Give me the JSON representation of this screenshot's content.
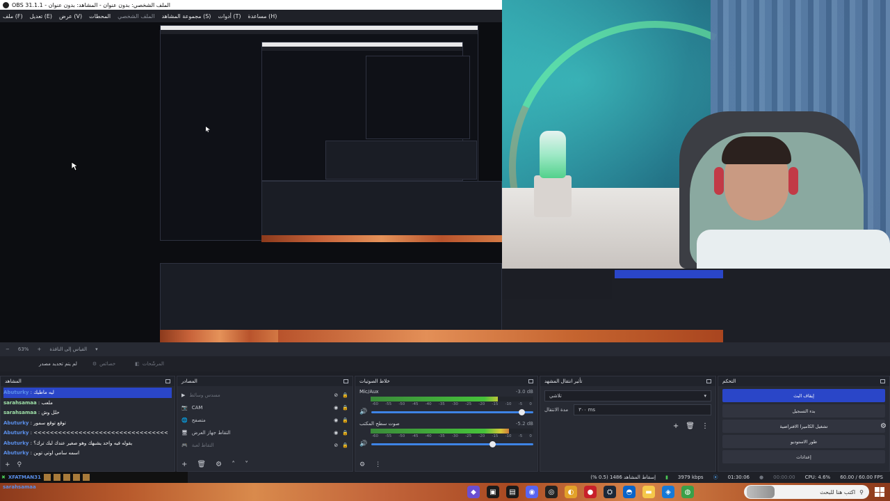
{
  "window": {
    "title": "OBS 31.1.1 - الملف الشخصي: بدون عنوان - المشاهد: بدون عنوان"
  },
  "menu": {
    "items": [
      "ملف (F)",
      "تعديل (E)",
      "عرض (V)",
      "المحطات",
      "الملف الشخصي",
      "مجموعة المشاهد (S)",
      "أدوات (T)",
      "مساعدة (H)"
    ],
    "dim_index": 4
  },
  "preview_toolbar": {
    "zoom": "63%",
    "scale_label": "القياس إلى النافذة"
  },
  "scene_toolbar": {
    "no_source": "لم يتم تحديد مصدر",
    "properties": "خصائص",
    "filters": "المرشّحات"
  },
  "docks": {
    "scenes": {
      "title": "المشاهد"
    },
    "sources": {
      "title": "المصادر"
    },
    "mixer": {
      "title": "خلاط الصوتيات"
    },
    "transitions": {
      "title": "تأثير انتقال المشهد"
    },
    "controls": {
      "title": "التحكم"
    }
  },
  "chat": [
    {
      "user": "Abuturky",
      "msg": "ليه ماطيك",
      "color": "blue",
      "selected": true
    },
    {
      "user": "sarahsamaa",
      "msg": "ملعب",
      "color": "green"
    },
    {
      "user": "sarahsamaa",
      "msg": "حلل وش",
      "color": "green"
    },
    {
      "user": "Abuturky",
      "msg": "توقع توقع سمور",
      "color": "blue"
    },
    {
      "user": "Abuturky",
      "msg": "<<<<<<<<<<<<<<<<<<<<<<<<<<<<<<<<<",
      "color": "blue"
    },
    {
      "user": "Abuturky",
      "msg": "يقوله فيه واحد يشبهك وهو صغير عندك لبك ترك؟",
      "color": "blue"
    },
    {
      "user": "Abuturky",
      "msg": "اسمه سامي اوتي توين",
      "color": "blue"
    }
  ],
  "sources": [
    {
      "label": "مسدس وسائط",
      "dim": true
    },
    {
      "label": "CAM",
      "dim": false
    },
    {
      "label": "متصفح",
      "dim": false
    },
    {
      "label": "التقاط جهاز العرض",
      "dim": false
    },
    {
      "label": "التقاط لعبة",
      "dim": true
    }
  ],
  "mixer": {
    "channels": [
      {
        "name": "Mic/Aux",
        "db": "-3.0 dB",
        "level": 0.78,
        "fader": 0.93
      },
      {
        "name": "صوت سطح المكتب",
        "db": "-5.2 dB",
        "level": 0.85,
        "fader": 0.75
      }
    ],
    "ticks": [
      "-60",
      "-55",
      "-50",
      "-45",
      "-40",
      "-35",
      "-30",
      "-25",
      "-20",
      "-15",
      "-10",
      "-5",
      "0"
    ]
  },
  "transitions": {
    "selected": "تلاشي",
    "duration_label": "مدة الانتقال",
    "duration_value": "٣٠٠ ms"
  },
  "controls": {
    "buttons": [
      "إيقاف البث",
      "بدء التسجيل",
      "تشغيل الكاميرا الافتراضية",
      "طور الاستوديو",
      "إعدادات"
    ]
  },
  "status": {
    "dropped": "إسقاط المشاهد 1486 (0.5 %)",
    "bitrate": "3979 kbps",
    "stream_time": "01:30:06",
    "rec_time": "00:00:00",
    "cpu": "CPU: 4.6%",
    "fps": "60.00 / 60.00 FPS"
  },
  "overlay_chat": {
    "user": "XFATMAN31",
    "user2": "sarahsamaa"
  },
  "taskbar": {
    "search_placeholder": "اكتب هنا للبحث"
  },
  "colors": {
    "accent": "#2a46c8",
    "meter_green": "#46c23a",
    "meter_yellow": "#d7c738",
    "meter_red": "#c2303a"
  }
}
